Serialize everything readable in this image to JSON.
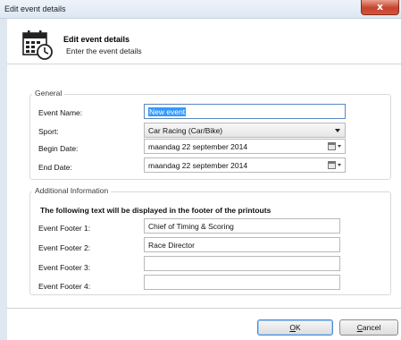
{
  "window": {
    "title": "Edit event details",
    "close_glyph": "x"
  },
  "header": {
    "title": "Edit event details",
    "subtitle": "Enter the event details",
    "icon": "calendar-clock-icon"
  },
  "general": {
    "legend": "General",
    "fields": {
      "event_name": {
        "label": "Event Name:",
        "value": "New event"
      },
      "sport": {
        "label": "Sport:",
        "value": "Car Racing (Car/Bike)"
      },
      "begin_date": {
        "label": "Begin Date:",
        "value": "maandag  22 september 2014"
      },
      "end_date": {
        "label": "End Date:",
        "value": "maandag  22 september 2014"
      }
    }
  },
  "additional": {
    "legend": "Additional Information",
    "note": "The following text will be displayed in the footer of the printouts",
    "footers": [
      {
        "label": "Event Footer 1:",
        "value": "Chief of Timing & Scoring"
      },
      {
        "label": "Event Footer 2:",
        "value": "Race Director"
      },
      {
        "label": "Event Footer 3:",
        "value": ""
      },
      {
        "label": "Event Footer 4:",
        "value": ""
      }
    ]
  },
  "buttons": {
    "ok": {
      "mnemonic": "O",
      "rest": "K"
    },
    "cancel": {
      "mnemonic": "C",
      "rest": "ancel"
    }
  },
  "colors": {
    "selection": "#3399ff",
    "close_button": "#c8432c",
    "focus_border": "#5a86c4"
  }
}
